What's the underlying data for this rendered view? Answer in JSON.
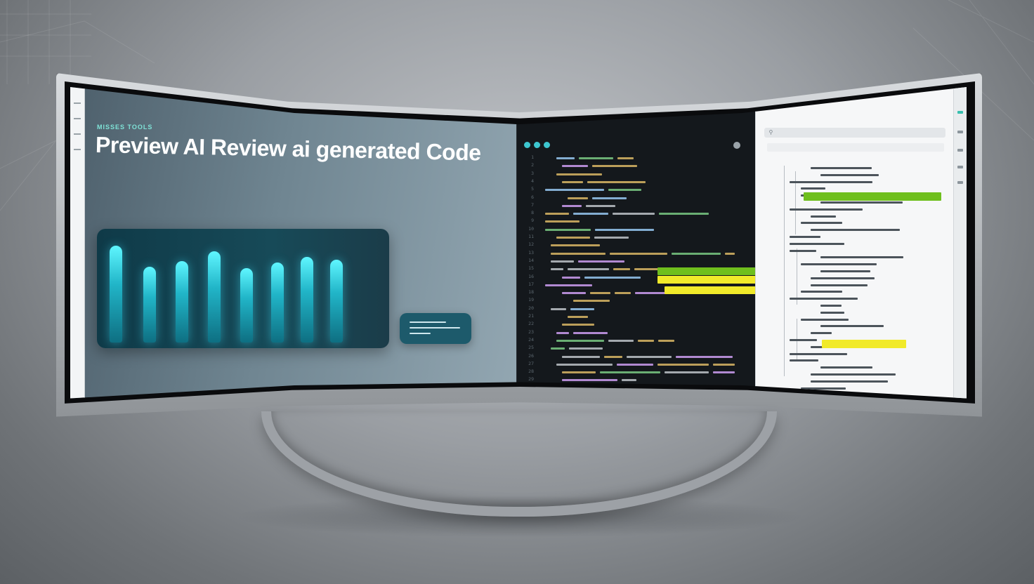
{
  "preview": {
    "eyebrow": "MISSES TOOLS",
    "title": "Preview AI Review ai generated Code"
  },
  "code_editor": {
    "line_count": 30
  },
  "review_panel": {
    "search_placeholder": ""
  },
  "icons": {
    "window_controls": [
      "dot-teal",
      "dot-teal",
      "dot-teal"
    ],
    "search": "search-icon",
    "rail": [
      "menu-icon",
      "settings-icon"
    ]
  },
  "colors": {
    "bar_accent": "#2fd4e8",
    "highlight_green": "#6fbf1d",
    "highlight_yellow": "#f1ea2a",
    "code_bg": "#14181c",
    "review_bg": "#f6f7f8"
  }
}
